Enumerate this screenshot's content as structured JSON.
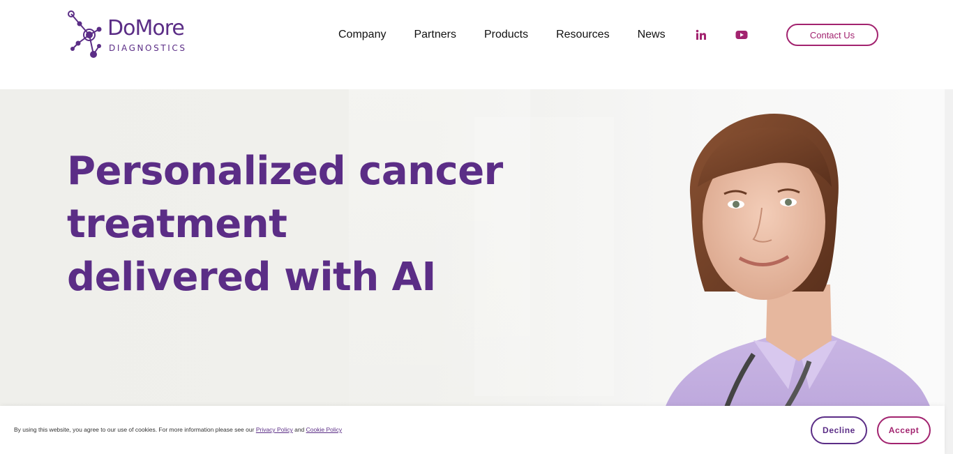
{
  "brand": {
    "name": "DoMore",
    "tagline": "DIAGNOSTICS",
    "color_primary": "#5b2d86",
    "color_accent": "#a2236f"
  },
  "nav": {
    "items": [
      {
        "label": "Company"
      },
      {
        "label": "Partners"
      },
      {
        "label": "Products"
      },
      {
        "label": "Resources"
      },
      {
        "label": "News"
      }
    ],
    "social": [
      {
        "icon": "linkedin-icon"
      },
      {
        "icon": "youtube-icon"
      }
    ],
    "contact_label": "Contact Us"
  },
  "hero": {
    "title_lines": [
      "Personalized cancer",
      "treatment",
      "delivered with AI"
    ]
  },
  "cookie": {
    "text_before": "By using this website, you agree to our use of cookies. For more information please see our",
    "privacy_link": "Privacy Policy",
    "and": "and",
    "cookie_link": "Cookie Policy",
    "decline_label": "Decline",
    "accept_label": "Accept"
  }
}
